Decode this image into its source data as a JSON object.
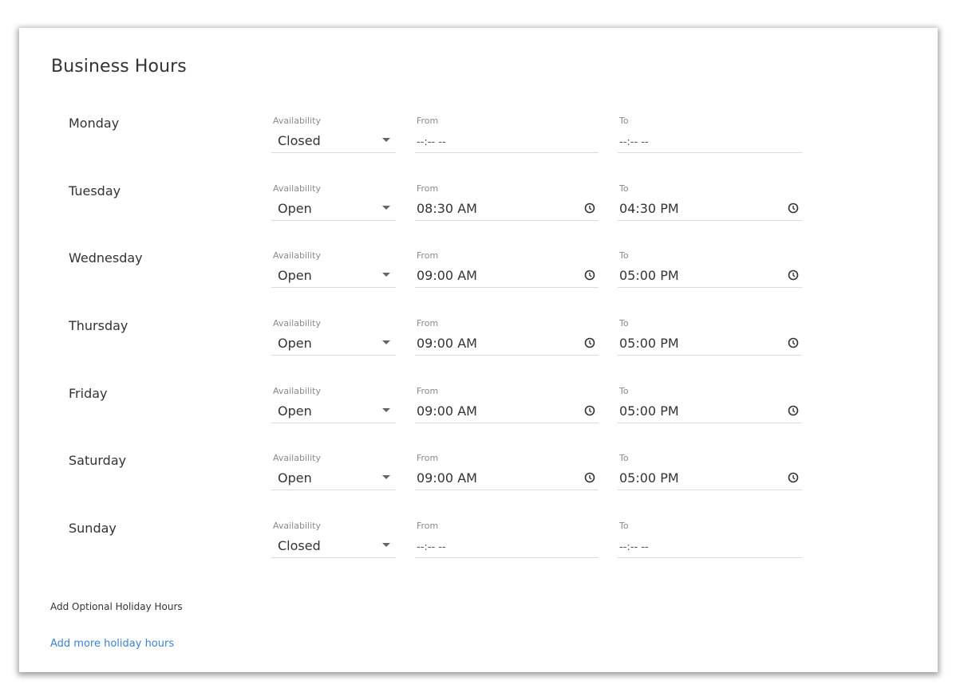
{
  "title": "Business Hours",
  "labels": {
    "availability": "Availability",
    "from": "From",
    "to": "To"
  },
  "days": [
    {
      "name": "Monday",
      "availability": "Closed",
      "from": "--:-- --",
      "to": "--:-- --"
    },
    {
      "name": "Tuesday",
      "availability": "Open",
      "from": "08:30 AM",
      "to": "04:30 PM"
    },
    {
      "name": "Wednesday",
      "availability": "Open",
      "from": "09:00 AM",
      "to": "05:00 PM"
    },
    {
      "name": "Thursday",
      "availability": "Open",
      "from": "09:00 AM",
      "to": "05:00 PM"
    },
    {
      "name": "Friday",
      "availability": "Open",
      "from": "09:00 AM",
      "to": "05:00 PM"
    },
    {
      "name": "Saturday",
      "availability": "Open",
      "from": "09:00 AM",
      "to": "05:00 PM"
    },
    {
      "name": "Sunday",
      "availability": "Closed",
      "from": "--:-- --",
      "to": "--:-- --"
    }
  ],
  "holiday": {
    "heading": "Add Optional Holiday Hours",
    "link": "Add more holiday hours"
  },
  "colors": {
    "link": "#3b82d8",
    "text": "#333333",
    "label": "#8a8a8a",
    "underline": "#dcdcdc"
  },
  "icons": {
    "dropdown": "chevron-down-icon",
    "time": "clock-icon"
  }
}
